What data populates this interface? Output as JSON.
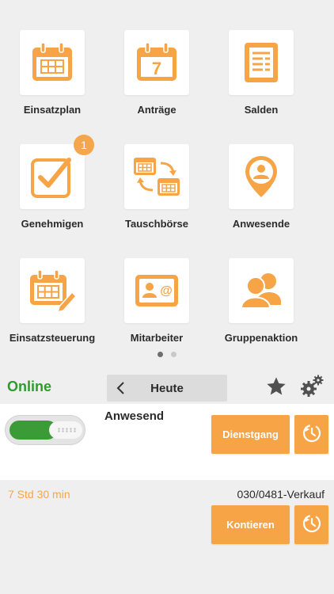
{
  "tiles": [
    {
      "label": "Einsatzplan",
      "icon": "calendar-grid-icon"
    },
    {
      "label": "Anträge",
      "icon": "calendar-seven-icon",
      "day": "7"
    },
    {
      "label": "Salden",
      "icon": "balance-sheet-icon"
    },
    {
      "label": "Genehmigen",
      "icon": "approve-checkbox-icon",
      "badge": "1"
    },
    {
      "label": "Tauschbörse",
      "icon": "swap-calendars-icon"
    },
    {
      "label": "Anwesende",
      "icon": "person-location-pin-icon"
    },
    {
      "label": "Einsatzsteuerung",
      "icon": "calendar-edit-icon"
    },
    {
      "label": "Mitarbeiter",
      "icon": "contact-card-icon"
    },
    {
      "label": "Gruppenaktion",
      "icon": "group-people-icon"
    }
  ],
  "pager": {
    "pages": 2,
    "active": 1
  },
  "topbar": {
    "online_label": "Online",
    "day_title": "Heute"
  },
  "status": {
    "title": "Anwesend",
    "toggle_on": true,
    "dienstgang_label": "Dienstgang"
  },
  "booking": {
    "hours": "7 Std 30 min",
    "account": "030/0481-Verkauf",
    "kontieren_label": "Kontieren"
  },
  "colors": {
    "accent": "#f7a447",
    "online": "#2f9a2f",
    "badge": "#f5a54b"
  }
}
